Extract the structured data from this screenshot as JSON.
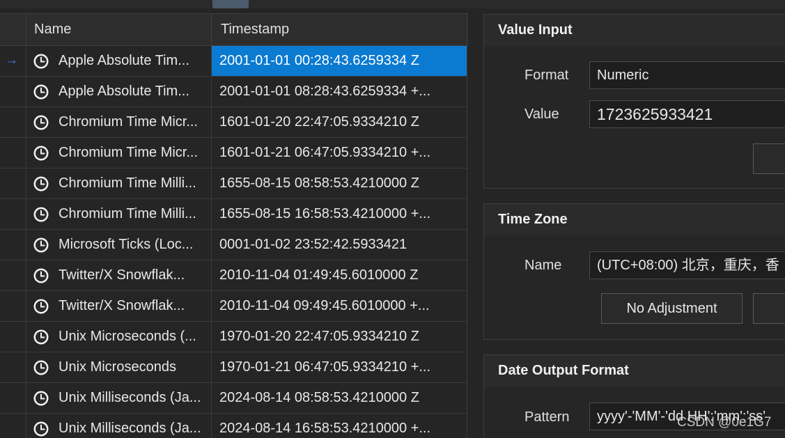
{
  "grid": {
    "columns": {
      "name": "Name",
      "timestamp": "Timestamp"
    },
    "rows": [
      {
        "name": "Apple Absolute Tim...",
        "timestamp": "2001-01-01 00:28:43.6259334 Z",
        "selected": true,
        "current": true
      },
      {
        "name": "Apple Absolute Tim...",
        "timestamp": "2001-01-01 08:28:43.6259334 +..."
      },
      {
        "name": "Chromium Time Micr...",
        "timestamp": "1601-01-20 22:47:05.9334210 Z"
      },
      {
        "name": "Chromium Time Micr...",
        "timestamp": "1601-01-21 06:47:05.9334210 +..."
      },
      {
        "name": "Chromium Time Milli...",
        "timestamp": "1655-08-15 08:58:53.4210000 Z"
      },
      {
        "name": "Chromium Time Milli...",
        "timestamp": "1655-08-15 16:58:53.4210000 +..."
      },
      {
        "name": "Microsoft Ticks (Loc...",
        "timestamp": "0001-01-02 23:52:42.5933421"
      },
      {
        "name": "Twitter/X Snowflak...",
        "timestamp": "2010-11-04 01:49:45.6010000 Z"
      },
      {
        "name": "Twitter/X Snowflak...",
        "timestamp": "2010-11-04 09:49:45.6010000 +..."
      },
      {
        "name": "Unix Microseconds (...",
        "timestamp": "1970-01-20 22:47:05.9334210 Z"
      },
      {
        "name": "Unix Microseconds",
        "timestamp": "1970-01-21 06:47:05.9334210 +..."
      },
      {
        "name": "Unix Milliseconds (Ja...",
        "timestamp": "2024-08-14 08:58:53.4210000 Z"
      },
      {
        "name": "Unix Milliseconds (Ja...",
        "timestamp": "2024-08-14 16:58:53.4210000 +..."
      }
    ],
    "current_row_arrow": "→",
    "row_icon": "clock-icon",
    "selection_color": "#0b7ad1"
  },
  "value_input": {
    "title": "Value Input",
    "format_label": "Format",
    "format_value": "Numeric",
    "value_label": "Value",
    "value": "1723625933421"
  },
  "time_zone": {
    "title": "Time Zone",
    "name_label": "Name",
    "name_value": "(UTC+08:00) 北京，重庆，香",
    "no_adjustment_label": "No Adjustment"
  },
  "date_output_format": {
    "title": "Date Output Format",
    "pattern_label": "Pattern",
    "pattern_value": "yyyy'-'MM'-'dd HH':'mm':'ss'"
  },
  "watermark": "CSDN @0e1G7"
}
